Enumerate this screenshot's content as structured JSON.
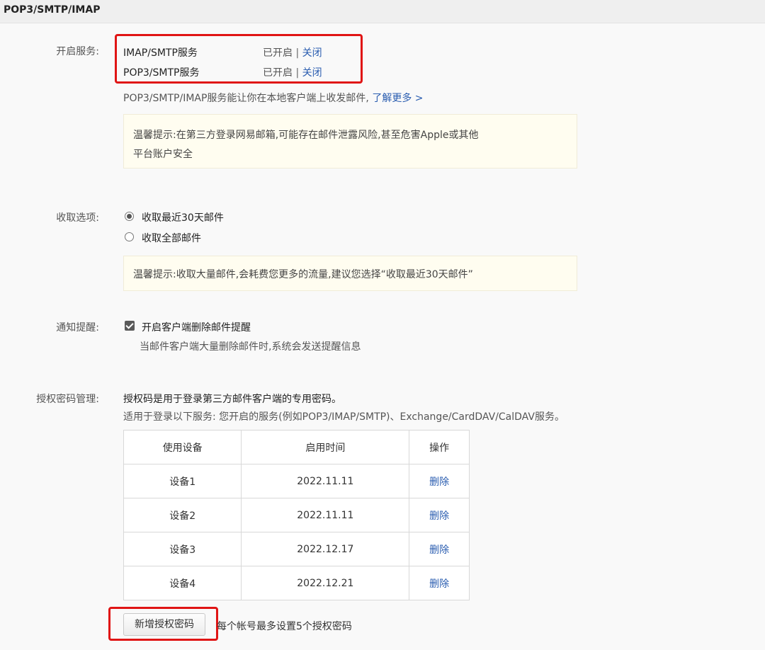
{
  "page_title": "POP3/SMTP/IMAP",
  "services": {
    "label": "开启服务:",
    "items": [
      {
        "name": "IMAP/SMTP服务",
        "status": "已开启",
        "sep": "|",
        "action": "关闭"
      },
      {
        "name": "POP3/SMTP服务",
        "status": "已开启",
        "sep": "|",
        "action": "关闭"
      }
    ],
    "description": "POP3/SMTP/IMAP服务能让你在本地客户端上收发邮件,",
    "learn_more": "了解更多 >",
    "tip_line1": "温馨提示:在第三方登录网易邮箱,可能存在邮件泄露风险,甚至危害Apple或其他",
    "tip_line2": "平台账户安全"
  },
  "receive": {
    "label": "收取选项:",
    "options": [
      {
        "label": "收取最近30天邮件",
        "checked": true
      },
      {
        "label": "收取全部邮件",
        "checked": false
      }
    ],
    "tip": "温馨提示:收取大量邮件,会耗费您更多的流量,建议您选择“收取最近30天邮件”"
  },
  "notify": {
    "label": "通知提醒:",
    "checkbox_label": "开启客户端删除邮件提醒",
    "checked": true,
    "description": "当邮件客户端大量删除邮件时,系统会发送提醒信息"
  },
  "auth": {
    "label": "授权密码管理:",
    "line1": "授权码是用于登录第三方邮件客户端的专用密码。",
    "line2": "适用于登录以下服务: 您开启的服务(例如POP3/IMAP/SMTP)、Exchange/CardDAV/CalDAV服务。",
    "columns": [
      "使用设备",
      "启用时间",
      "操作"
    ],
    "rows": [
      {
        "device": "设备1",
        "date": "2022.11.11",
        "action": "删除"
      },
      {
        "device": "设备2",
        "date": "2022.11.11",
        "action": "删除"
      },
      {
        "device": "设备3",
        "date": "2022.12.17",
        "action": "删除"
      },
      {
        "device": "设备4",
        "date": "2022.12.21",
        "action": "删除"
      }
    ],
    "add_button": "新增授权密码",
    "limit_note": "每个帐号最多设置5个授权密码"
  },
  "colors": {
    "link": "#2a5db0",
    "highlight_box": "#e01515",
    "tip_background": "#fffdf0"
  }
}
